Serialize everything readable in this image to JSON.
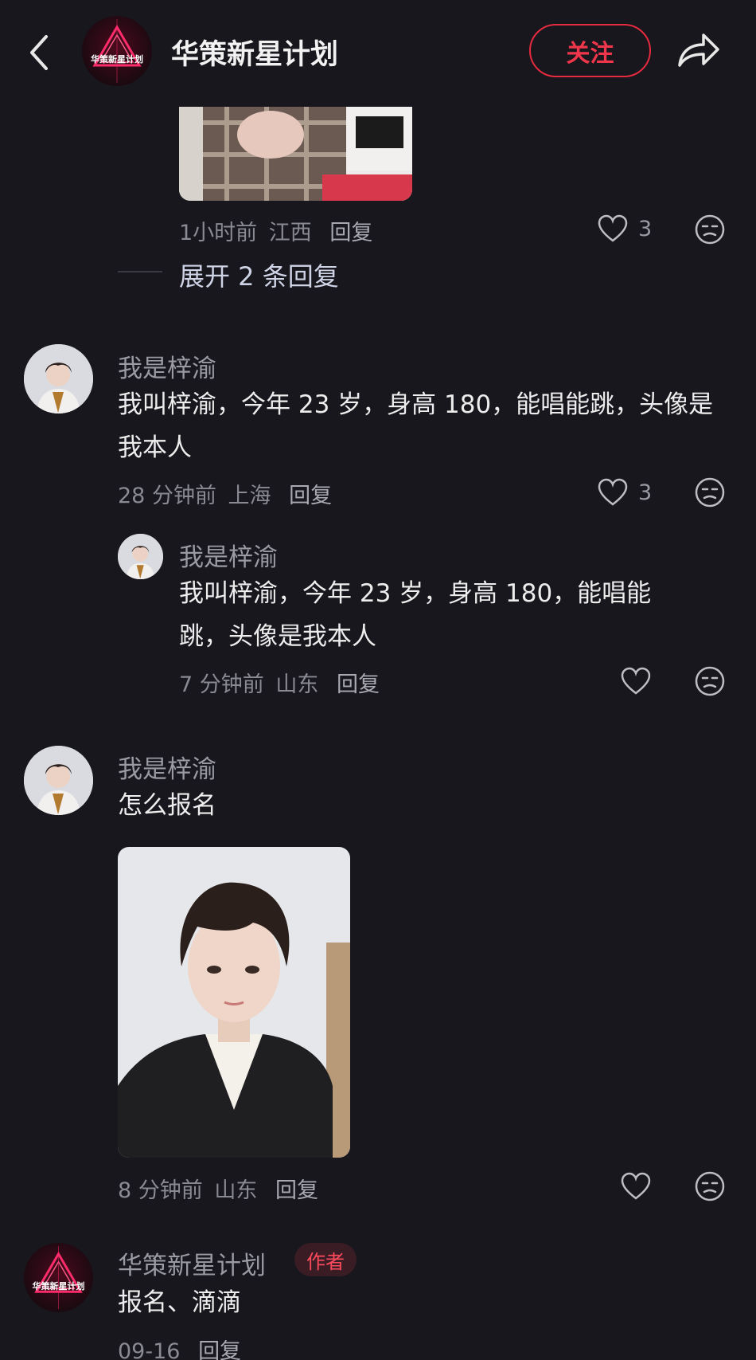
{
  "header": {
    "title": "华策新星计划",
    "follow_label": "关注",
    "logo_text": "华策新星计划"
  },
  "thread": [
    {
      "meta": {
        "time": "1小时前",
        "location": "江西",
        "reply": "回复"
      },
      "likes": "3",
      "expand": "展开 2 条回复"
    },
    {
      "username": "我是梓渝",
      "text": "我叫梓渝，今年 23 岁，身高 180，能唱能跳，头像是我本人",
      "meta": {
        "time": "28 分钟前",
        "location": "上海",
        "reply": "回复"
      },
      "likes": "3"
    },
    {
      "username": "我是梓渝",
      "text": "我叫梓渝，今年 23 岁，身高 180，能唱能跳，头像是我本人",
      "meta": {
        "time": "7 分钟前",
        "location": "山东",
        "reply": "回复"
      }
    },
    {
      "username": "我是梓渝",
      "text": "怎么报名",
      "meta": {
        "time": "8 分钟前",
        "location": "山东",
        "reply": "回复"
      }
    },
    {
      "username": "华策新星计划",
      "badge": "作者",
      "text": "报名、滴滴",
      "meta": {
        "time": "09-16",
        "reply": "回复"
      }
    }
  ],
  "colors": {
    "background": "#17171d",
    "accent": "#e62a3f",
    "text": "#ededed",
    "muted": "#8a8a93"
  },
  "icons": [
    "back-arrow-icon",
    "share-icon",
    "heart-icon",
    "emoji-icon"
  ]
}
